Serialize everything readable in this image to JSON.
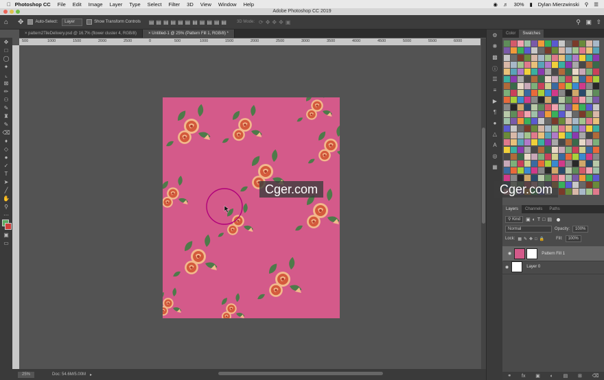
{
  "menubar": {
    "app": "Photoshop CC",
    "items": [
      "File",
      "Edit",
      "Image",
      "Layer",
      "Type",
      "Select",
      "Filter",
      "3D",
      "View",
      "Window",
      "Help"
    ],
    "battery": "30%",
    "user": "Dylan Mierzwinski"
  },
  "window": {
    "title": "Adobe Photoshop CC 2019"
  },
  "options": {
    "auto_select_label": "Auto-Select:",
    "auto_select_value": "Layer",
    "transform_label": "Show Transform Controls",
    "mode_label": "3D Mode:"
  },
  "tabs": [
    {
      "label": "pattern2TileDelivery.psd @ 16.7% (flower cluster 4, RGB/8)"
    },
    {
      "label": "Untitled-1 @ 25% (Pattern Fill 1, RGB/8) *"
    }
  ],
  "ruler": {
    "ticks": [
      "500",
      "1000",
      "1500",
      "2000",
      "2500",
      "0",
      "500",
      "1000",
      "1500",
      "2000",
      "2500",
      "3000",
      "3500",
      "4000",
      "4500",
      "5000",
      "5500",
      "6000"
    ]
  },
  "status": {
    "zoom": "25%",
    "doc": "Doc: 54.6M/5.00M"
  },
  "panels": {
    "color_tabs": [
      "Color",
      "Swatches"
    ],
    "layer_tabs": [
      "Layers",
      "Channels",
      "Paths"
    ],
    "kind": "Kind",
    "blend": "Normal",
    "opacity_label": "Opacity:",
    "opacity": "100%",
    "lock_label": "Lock:",
    "fill_label": "Fill:",
    "fill": "100%",
    "layers": [
      {
        "name": "Pattern Fill 1"
      },
      {
        "name": "Layer 0"
      }
    ]
  },
  "watermarks": [
    "Cger.com",
    "Cger.com"
  ],
  "colors": {
    "accent": "#d45a8a",
    "brush_ring": "#b0007a"
  }
}
